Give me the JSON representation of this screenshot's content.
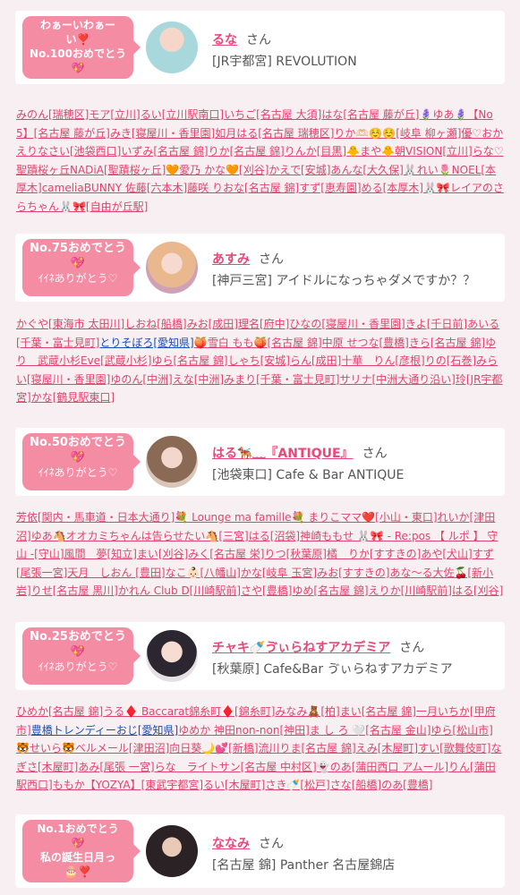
{
  "cards": [
    {
      "badge": [
        "わぁーいわぁー",
        "い❣️",
        "No.100おめでとう",
        "💖"
      ],
      "name": "るな",
      "honorific": "さん",
      "shop": "[JR宇都宮] REVOLUTION"
    },
    {
      "badge": [
        "No.75おめでとう",
        "💖",
        "ｲｲﾈありがとう♡"
      ],
      "name": "あすみ",
      "honorific": "さん",
      "shop": "[神戸三宮] アイドルになっちゃダメですか？？"
    },
    {
      "badge": [
        "No.50おめでとう",
        "💖",
        "ｲｲﾈありがとう♡"
      ],
      "name": "はる🐕‍🦺﹏『ANTIQUE』",
      "honorific": "さん",
      "shop": "[池袋東口] Cafe & Bar ANTIQUE"
    },
    {
      "badge": [
        "No.25おめでとう",
        "💖",
        "ｲｲﾈありがとう♡"
      ],
      "name": "チャキ🍼ゔぃらねすアカデミア",
      "honorific": "さん",
      "shop": "[秋葉原] Cafe&Bar ゔぃらねすアカデミア"
    },
    {
      "badge": [
        "No.1おめでとう",
        "💖",
        "私の誕生日月っ",
        "🎂❣️"
      ],
      "name": "ななみ",
      "honorific": "さん",
      "shop": "[名古屋 錦] Panther 名古屋錦店"
    }
  ],
  "lists": [
    [
      "みのん[瑞穂区]",
      "モア[立川]",
      "るい[立川駅南口]",
      "いちご[名古屋 大須]",
      "はな[名古屋 藤が丘]",
      "🪻ゆあ🪻【No5】[名古屋 藤が丘]",
      "みき[寝屋川・香里園]",
      "如月はる[名古屋 瑞穂区]",
      "りか🫶🏻☺️☺️[岐阜 柳ヶ瀬]",
      "優♡おかえりなさい[池袋西口]",
      "いずみ[名古屋 錦]",
      "りか[名古屋 錦]",
      "りんか[目黒]",
      "🐥まや🐥朝VISION[立川]",
      "らな♡聖蹟桜ヶ丘NADiA[聖蹟桜ヶ丘]",
      "🧡愛乃 かな🧡[刈谷]",
      "かえで[安城]",
      "あんな[大久保]",
      "🐰れい🌷NOEL[本厚木]",
      "cameliaBUNNY 佐藤[六本木]",
      "藤咲 りおな[名古屋 錦]",
      "すず[恵寿園]",
      "める[本厚木]",
      "🐰🎀レイアのさらちゃん🐰🎀[自由が丘駅]"
    ],
    [
      "かぐや[東海市 太田川]",
      "しおね[船橋]",
      "みお[成田]",
      "理名[府中]",
      "ひなの[寝屋川・香里園]",
      "きよ[千日前]",
      "あいる[千葉・富士見町]",
      "とりそぼろ[愛知県]",
      "🍑雪白 もも🍑[名古屋 錦]",
      "中原 せつな[豊橋]",
      "きら[名古屋 錦]",
      "ゆり　武蔵小杉Eve[武蔵小杉]",
      "ゆら[名古屋 錦]",
      "しゃち[安城]",
      "らん[成田]",
      "十華　りん[彦根]",
      "りの[石巻]",
      "みらい[寝屋川・香里園]",
      "ゆのん[中洲]",
      "えな[中洲]",
      "みまり[千葉・富士見町]",
      "サリナ[中洲大通り沿い]",
      "玲[JR宇都宮]",
      "かな[鶴見駅東口]"
    ],
    [
      "芳依[関内・馬車道・日本大通り]",
      "💐 Lounge ma famille💐 まりこママ❤️[小山・東口]",
      "れいか[津田沼]",
      "ゆあ🐴オオカミちゃんは告らせたい🐴[三宮]",
      "はる[沼袋]",
      "神崎ももせ 🐰🎀 - Re:pos 【 ルポ 】 守山 -[守山]",
      "風間　夢[知立]",
      "まい[刈谷]",
      "みく[名古屋 栄]",
      "りつ[秋葉原]",
      "橘　りか[すすきの]",
      "あや[犬山]",
      "すず[尾張一宮]",
      "天月　しおん [豊田]",
      "なこ👶🏻[八幡山]",
      "かな[岐阜 玉宮]",
      "みお[すすきの]",
      "あな〜る大佐🍒[新小岩]",
      "りせ[名古屋 黒川]",
      "かれん Club D[川崎駅前]",
      "さや[豊橋]",
      "ゆめ[名古屋 錦]",
      "えりか[川崎駅前]",
      "はる[刈谷]"
    ],
    [
      "ひめか[名古屋 錦]",
      "うる♦️ Baccarat錦糸町♦️[錦糸町]",
      "みなみ🧸[柏]",
      "まい[名古屋 錦]",
      "一月いちか[甲府市]",
      "豊橋トレンディーおじ[愛知県]",
      "ゆめか 神田non-non[神田]",
      "ま し ろ 🤍[名古屋 金山]",
      "ゆら[松山市]",
      "🐯せいら🐯ベルメール[津田沼]",
      "向日葵🌙💕[新橋]",
      "流川りま[名古屋 錦]",
      "えみ[木屋町]",
      "すい[歌舞伎町]",
      "なぎさ[木屋町]",
      "あみ[尾張 一宮]",
      "らな　ライトサン[名古屋 中村区]",
      "👻のあ[蒲田西口 アムール]",
      "りん[蒲田駅西口]",
      "ももか【YOZYA】[東武宇都宮]",
      "るい[木屋町]",
      "さき🍼[松戸]",
      "さな[船橋]",
      "のあ[豊橋]"
    ]
  ]
}
